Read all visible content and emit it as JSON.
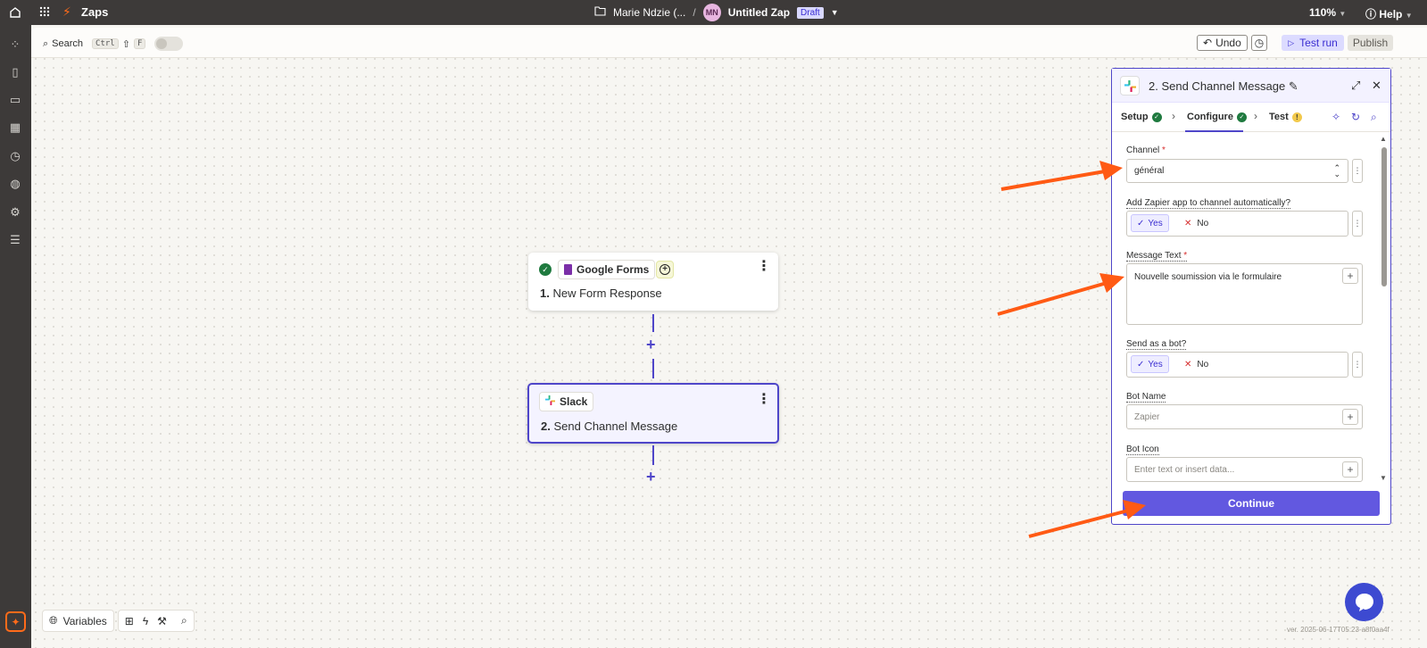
{
  "app": {
    "name": "Zaps"
  },
  "breadcrumb": {
    "folder": "Marie Ndzie (...",
    "separator": "/",
    "avatar_initials": "MN",
    "zap_name": "Untitled Zap",
    "status_badge": "Draft"
  },
  "topbar": {
    "zoom": "110%",
    "help": "Help"
  },
  "toolbar": {
    "search": "Search",
    "shortcut_ctrl": "Ctrl",
    "shortcut_shift": "⇧",
    "shortcut_f": "F",
    "undo": "Undo",
    "test_run": "Test run",
    "publish": "Publish"
  },
  "steps": [
    {
      "app": "Google Forms",
      "number": "1.",
      "title": "New Form Response"
    },
    {
      "app": "Slack",
      "number": "2.",
      "title": "Send Channel Message"
    }
  ],
  "panel": {
    "title": "2. Send Channel Message",
    "tabs": [
      {
        "label": "Setup"
      },
      {
        "label": "Configure"
      },
      {
        "label": "Test"
      }
    ],
    "fields": {
      "channel": {
        "label": "Channel",
        "required": "*",
        "value": "général"
      },
      "add_app": {
        "label": "Add Zapier app to channel automatically?",
        "yes": "Yes",
        "no": "No"
      },
      "message": {
        "label": "Message Text",
        "required": "*",
        "value": "Nouvelle soumission via le formulaire"
      },
      "send_as_bot": {
        "label": "Send as a bot?",
        "yes": "Yes",
        "no": "No"
      },
      "bot_name": {
        "label": "Bot Name",
        "placeholder": "Zapier"
      },
      "bot_icon": {
        "label": "Bot Icon",
        "placeholder": "Enter text or insert data..."
      }
    },
    "continue": "Continue"
  },
  "bottom_toolbar": {
    "variables": "Variables"
  },
  "version": "ver. 2025-06-17T05:23-a8f0aa4f",
  "colors": {
    "accent": "#4f46c9",
    "brand_orange": "#ff6b1a",
    "topbar": "#3d3a39",
    "continue": "#6258e0",
    "success": "#1f7a3f"
  }
}
